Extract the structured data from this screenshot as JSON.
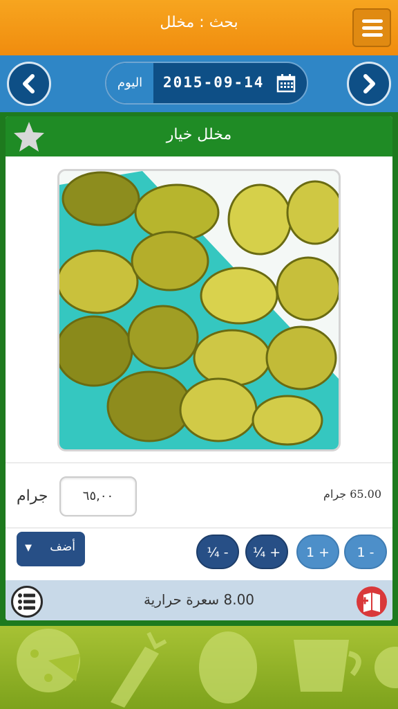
{
  "header": {
    "title": "بحث : مخلل",
    "menu_icon": "hamburger-menu-icon"
  },
  "date_bar": {
    "today_label": "اليوم",
    "date": "2015-09-14",
    "prev_icon": "chevron-left-icon",
    "next_icon": "chevron-right-icon",
    "calendar_icon": "calendar-icon"
  },
  "food": {
    "name": "مخلل خيار",
    "favorite_icon": "star-icon",
    "image_alt": "pickled cucumber slices"
  },
  "quantity": {
    "unit": "جرام",
    "value": "٦٥,٠٠",
    "amount_text": "65.00 جرام"
  },
  "actions": {
    "add_label": "أضف",
    "add_arrow": "▼",
    "minus_one": "1 -",
    "plus_one": "1 +",
    "plus_quarter": "¼ +",
    "minus_quarter": "¼ -"
  },
  "footer": {
    "calories_text": "8.00 سعرة حرارية",
    "list_icon": "list-icon",
    "book_icon": "add-to-diary-icon"
  },
  "colors": {
    "header_orange": "#f7a51f",
    "date_blue": "#2f86c6",
    "navy": "#0e4f86",
    "card_green": "#1f8b25",
    "button_dark": "#274f86",
    "button_light": "#4d8fc9",
    "bottom_green": "#a7c234"
  }
}
